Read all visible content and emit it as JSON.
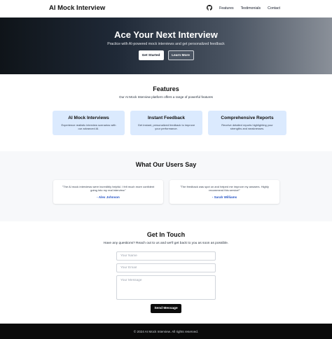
{
  "header": {
    "brand": "AI Mock Interview",
    "nav": [
      "Features",
      "Testimonials",
      "Contact"
    ],
    "icon": "github-icon"
  },
  "hero": {
    "title": "Ace Your Next Interview",
    "subtitle": "Practice with AI-powered mock interviews and get personalized feedback",
    "primary_button": "Get Started",
    "secondary_button": "Learn More"
  },
  "features": {
    "title": "Features",
    "subtitle": "Our AI Mock Interview platform offers a range of powerful features",
    "cards": [
      {
        "title": "AI Mock Interviews",
        "desc": "Experience realistic interview scenarios with our advanced AI."
      },
      {
        "title": "Instant Feedback",
        "desc": "Get instant, personalized feedback to improve your performance."
      },
      {
        "title": "Comprehensive Reports",
        "desc": "Receive detailed reports highlighting your strengths and weaknesses."
      }
    ]
  },
  "testimonials": {
    "title": "What Our Users Say",
    "items": [
      {
        "quote": "\"The AI mock interviews were incredibly helpful. I felt much more confident going into my real interview.\"",
        "author": "- Alex Johnson"
      },
      {
        "quote": "\"The feedback was spot on and helped me improve my answers. Highly recommend this service!\"",
        "author": "- Sarah Williams"
      }
    ]
  },
  "contact": {
    "title": "Get In Touch",
    "subtitle": "Have any questions? Reach out to us and we'll get back to you as soon as possible.",
    "name_placeholder": "Your Name",
    "email_placeholder": "Your Email",
    "message_placeholder": "Your Message",
    "send_button": "Send Message"
  },
  "footer": {
    "text": "© 2024 AI Mock Interview. All rights reserved."
  },
  "colors": {
    "accent": "#2554c7",
    "card_bg": "#dbeafe",
    "dark": "#0b0b0b"
  }
}
